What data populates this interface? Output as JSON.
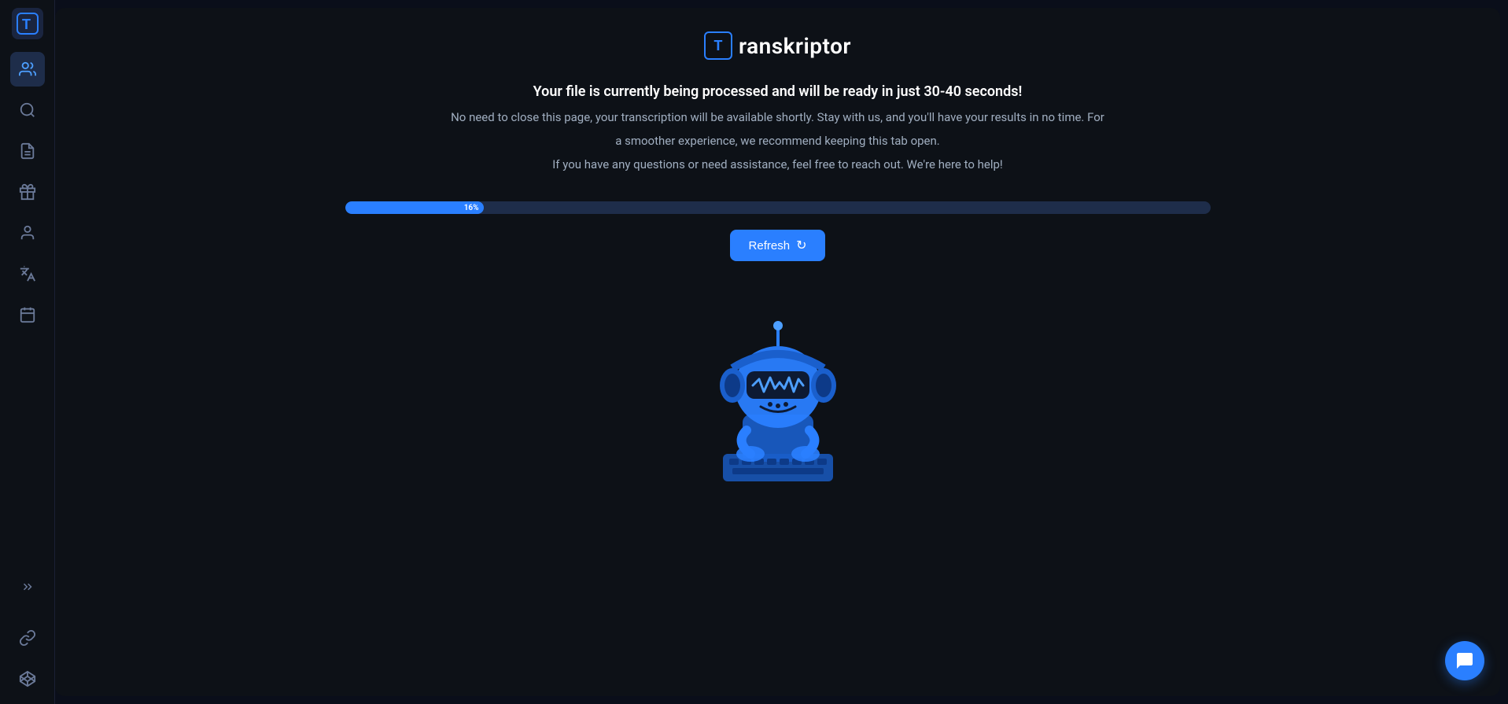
{
  "app": {
    "name": "ranskriptor",
    "logo_letter": "T"
  },
  "header": {
    "title": "Transkriptor",
    "logo_bracket": "T"
  },
  "status": {
    "line1": "Your file is currently being processed and will be ready in just 30-40 seconds!",
    "line2": "No need to close this page, your transcription will be available shortly. Stay with us, and you'll have your results in no time. For",
    "line3": "a smoother experience, we recommend keeping this tab open.",
    "line4": "If you have any questions or need assistance, feel free to reach out. We're here to help!"
  },
  "progress": {
    "value": 16,
    "label": "16%"
  },
  "refresh_button": {
    "label": "Refresh"
  },
  "sidebar": {
    "items": [
      {
        "id": "team",
        "icon": "👥",
        "active": true
      },
      {
        "id": "search",
        "icon": "🔍",
        "active": false
      },
      {
        "id": "document",
        "icon": "📄",
        "active": false
      },
      {
        "id": "gift",
        "icon": "🎁",
        "active": false
      },
      {
        "id": "user",
        "icon": "👤",
        "active": false
      },
      {
        "id": "translate",
        "icon": "A̲",
        "active": false
      },
      {
        "id": "calendar",
        "icon": "📅",
        "active": false
      },
      {
        "id": "link",
        "icon": "🔗",
        "active": false
      },
      {
        "id": "diamond",
        "icon": "💎",
        "active": false
      }
    ],
    "expand_label": ">>"
  },
  "chat": {
    "icon": "💬"
  }
}
